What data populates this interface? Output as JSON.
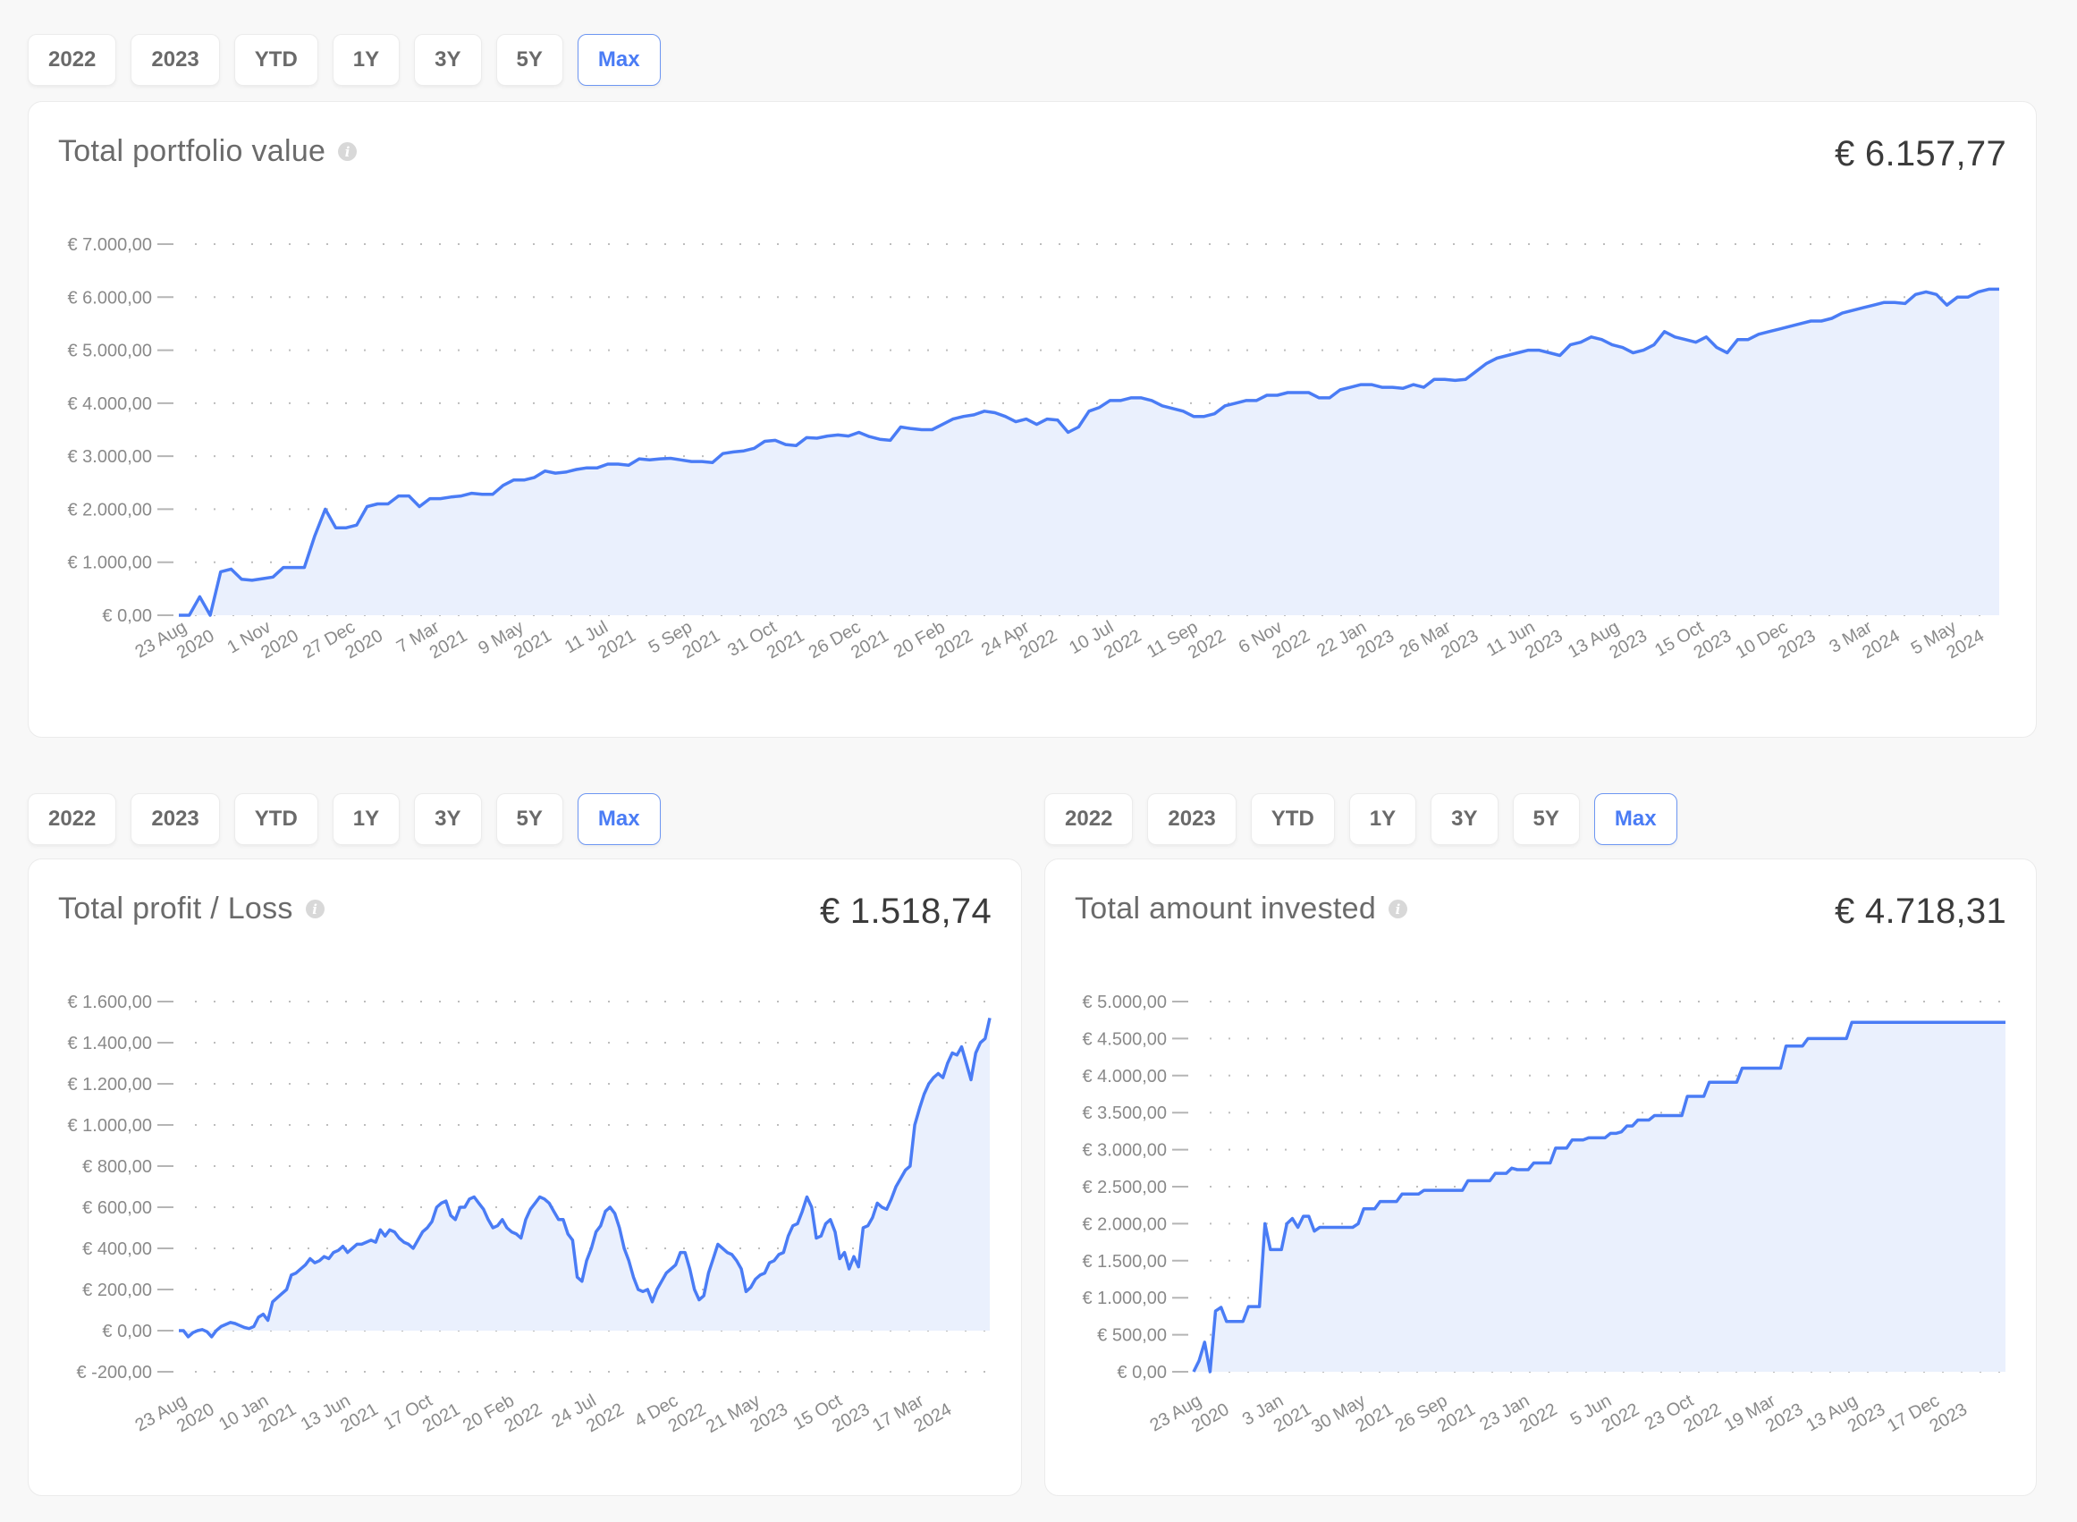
{
  "filters": [
    "2022",
    "2023",
    "YTD",
    "1Y",
    "3Y",
    "5Y",
    "Max"
  ],
  "active_filter": "Max",
  "colors": {
    "accent": "#4a7cf5",
    "line": "#4a7cf5",
    "fill": "#eaf0fd",
    "grid": "#bdbdbd",
    "background": "#f8f8f8"
  },
  "cards": {
    "portfolio": {
      "title": "Total portfolio value",
      "value": "€ 6.157,77"
    },
    "profit": {
      "title": "Total profit / Loss",
      "value": "€ 1.518,74"
    },
    "invested": {
      "title": "Total amount invested",
      "value": "€ 4.718,31"
    }
  },
  "chart_data": [
    {
      "type": "area",
      "title": "Total portfolio value",
      "ylabel": "EUR",
      "ylim": [
        0,
        7000
      ],
      "yticks": [
        0,
        1000,
        2000,
        3000,
        4000,
        5000,
        6000,
        7000
      ],
      "ytick_labels": [
        "€ 0,00",
        "€ 1.000,00",
        "€ 2.000,00",
        "€ 3.000,00",
        "€ 4.000,00",
        "€ 5.000,00",
        "€ 6.000,00",
        "€ 7.000,00"
      ],
      "xtick_labels": [
        [
          "23 Aug",
          "2020"
        ],
        [
          "1 Nov",
          "2020"
        ],
        [
          "27 Dec",
          "2020"
        ],
        [
          "7 Mar",
          "2021"
        ],
        [
          "9 May",
          "2021"
        ],
        [
          "11 Jul",
          "2021"
        ],
        [
          "5 Sep",
          "2021"
        ],
        [
          "31 Oct",
          "2021"
        ],
        [
          "26 Dec",
          "2021"
        ],
        [
          "20 Feb",
          "2022"
        ],
        [
          "24 Apr",
          "2022"
        ],
        [
          "10 Jul",
          "2022"
        ],
        [
          "11 Sep",
          "2022"
        ],
        [
          "6 Nov",
          "2022"
        ],
        [
          "22 Jan",
          "2023"
        ],
        [
          "26 Mar",
          "2023"
        ],
        [
          "11 Jun",
          "2023"
        ],
        [
          "13 Aug",
          "2023"
        ],
        [
          "15 Oct",
          "2023"
        ],
        [
          "10 Dec",
          "2023"
        ],
        [
          "3 Mar",
          "2024"
        ],
        [
          "5 May",
          "2024"
        ]
      ],
      "grid": true,
      "values": [
        0,
        0,
        350,
        0,
        820,
        870,
        680,
        660,
        690,
        720,
        900,
        900,
        900,
        1500,
        2000,
        1650,
        1650,
        1700,
        2050,
        2100,
        2100,
        2250,
        2250,
        2050,
        2200,
        2200,
        2230,
        2250,
        2300,
        2280,
        2280,
        2450,
        2550,
        2550,
        2600,
        2720,
        2680,
        2700,
        2750,
        2780,
        2780,
        2850,
        2850,
        2830,
        2950,
        2930,
        2950,
        2960,
        2930,
        2900,
        2900,
        2880,
        3050,
        3080,
        3100,
        3150,
        3280,
        3300,
        3220,
        3200,
        3350,
        3340,
        3380,
        3400,
        3380,
        3450,
        3370,
        3320,
        3300,
        3550,
        3520,
        3500,
        3500,
        3600,
        3700,
        3750,
        3780,
        3850,
        3820,
        3750,
        3650,
        3700,
        3600,
        3700,
        3680,
        3450,
        3550,
        3850,
        3920,
        4050,
        4050,
        4100,
        4100,
        4050,
        3950,
        3900,
        3850,
        3750,
        3750,
        3800,
        3950,
        4000,
        4050,
        4050,
        4150,
        4150,
        4200,
        4200,
        4200,
        4100,
        4100,
        4250,
        4300,
        4350,
        4350,
        4300,
        4300,
        4280,
        4350,
        4300,
        4450,
        4450,
        4430,
        4450,
        4600,
        4750,
        4850,
        4900,
        4950,
        5000,
        5000,
        4950,
        4900,
        5100,
        5150,
        5250,
        5200,
        5100,
        5050,
        4950,
        5000,
        5100,
        5350,
        5250,
        5200,
        5150,
        5250,
        5050,
        4950,
        5200,
        5200,
        5300,
        5350,
        5400,
        5450,
        5500,
        5550,
        5550,
        5600,
        5700,
        5750,
        5800,
        5850,
        5900,
        5900,
        5880,
        6050,
        6100,
        6050,
        5850,
        6000,
        6000,
        6100,
        6150,
        6150
      ],
      "last_value": 6157.77
    },
    {
      "type": "area",
      "title": "Total profit / Loss",
      "ylabel": "EUR",
      "ylim": [
        -200,
        1600
      ],
      "yticks": [
        -200,
        0,
        200,
        400,
        600,
        800,
        1000,
        1200,
        1400,
        1600
      ],
      "ytick_labels": [
        "€ -200,00",
        "€ 0,00",
        "€ 200,00",
        "€ 400,00",
        "€ 600,00",
        "€ 800,00",
        "€ 1.000,00",
        "€ 1.200,00",
        "€ 1.400,00",
        "€ 1.600,00"
      ],
      "xtick_labels": [
        [
          "23 Aug",
          "2020"
        ],
        [
          "10 Jan",
          "2021"
        ],
        [
          "13 Jun",
          "2021"
        ],
        [
          "17 Oct",
          "2021"
        ],
        [
          "20 Feb",
          "2022"
        ],
        [
          "24 Jul",
          "2022"
        ],
        [
          "4 Dec",
          "2022"
        ],
        [
          "21 May",
          "2023"
        ],
        [
          "15 Oct",
          "2023"
        ],
        [
          "17 Mar",
          "2024"
        ]
      ],
      "grid": true,
      "values": [
        0,
        0,
        -30,
        -10,
        0,
        5,
        -5,
        -30,
        0,
        20,
        30,
        40,
        35,
        25,
        15,
        10,
        20,
        65,
        80,
        50,
        140,
        160,
        180,
        200,
        270,
        280,
        300,
        320,
        350,
        330,
        340,
        360,
        350,
        380,
        390,
        410,
        380,
        400,
        420,
        420,
        430,
        440,
        430,
        490,
        460,
        490,
        480,
        450,
        430,
        420,
        400,
        440,
        480,
        500,
        530,
        600,
        620,
        630,
        560,
        540,
        600,
        600,
        640,
        650,
        620,
        590,
        540,
        500,
        510,
        540,
        500,
        480,
        470,
        450,
        540,
        590,
        620,
        650,
        640,
        620,
        580,
        540,
        540,
        470,
        440,
        260,
        240,
        340,
        400,
        480,
        510,
        580,
        600,
        570,
        500,
        400,
        340,
        260,
        200,
        190,
        200,
        140,
        200,
        240,
        280,
        300,
        320,
        380,
        380,
        300,
        200,
        150,
        170,
        280,
        350,
        420,
        400,
        380,
        370,
        340,
        300,
        190,
        210,
        250,
        270,
        280,
        330,
        340,
        370,
        380,
        460,
        510,
        520,
        580,
        650,
        600,
        450,
        460,
        520,
        540,
        480,
        350,
        380,
        300,
        360,
        310,
        500,
        510,
        550,
        620,
        600,
        590,
        640,
        700,
        740,
        780,
        800,
        1000,
        1080,
        1150,
        1200,
        1230,
        1250,
        1230,
        1300,
        1350,
        1340,
        1380,
        1300,
        1220,
        1350,
        1400,
        1420,
        1520
      ]
    },
    {
      "type": "area",
      "title": "Total amount invested",
      "ylabel": "EUR",
      "ylim": [
        0,
        5000
      ],
      "yticks": [
        0,
        500,
        1000,
        1500,
        2000,
        2500,
        3000,
        3500,
        4000,
        4500,
        5000
      ],
      "ytick_labels": [
        "€ 0,00",
        "€ 500,00",
        "€ 1.000,00",
        "€ 1.500,00",
        "€ 2.000,00",
        "€ 2.500,00",
        "€ 3.000,00",
        "€ 3.500,00",
        "€ 4.000,00",
        "€ 4.500,00",
        "€ 5.000,00"
      ],
      "xtick_labels": [
        [
          "23 Aug",
          "2020"
        ],
        [
          "3 Jan",
          "2021"
        ],
        [
          "30 May",
          "2021"
        ],
        [
          "26 Sep",
          "2021"
        ],
        [
          "23 Jan",
          "2022"
        ],
        [
          "5 Jun",
          "2022"
        ],
        [
          "23 Oct",
          "2022"
        ],
        [
          "19 Mar",
          "2023"
        ],
        [
          "13 Aug",
          "2023"
        ],
        [
          "17 Dec",
          "2023"
        ]
      ],
      "grid": true,
      "values": [
        0,
        150,
        400,
        0,
        820,
        870,
        680,
        680,
        680,
        680,
        880,
        880,
        880,
        2000,
        1650,
        1650,
        1650,
        2000,
        2070,
        1950,
        2100,
        2100,
        1900,
        1950,
        1950,
        1950,
        1950,
        1950,
        1950,
        1950,
        2000,
        2200,
        2200,
        2200,
        2300,
        2300,
        2300,
        2300,
        2400,
        2400,
        2400,
        2400,
        2450,
        2450,
        2450,
        2450,
        2450,
        2450,
        2450,
        2450,
        2580,
        2580,
        2580,
        2580,
        2580,
        2680,
        2680,
        2680,
        2750,
        2730,
        2730,
        2730,
        2820,
        2820,
        2820,
        2820,
        3020,
        3020,
        3020,
        3130,
        3130,
        3130,
        3160,
        3160,
        3160,
        3160,
        3220,
        3220,
        3240,
        3320,
        3320,
        3400,
        3400,
        3400,
        3460,
        3460,
        3460,
        3460,
        3460,
        3460,
        3720,
        3720,
        3720,
        3720,
        3910,
        3910,
        3910,
        3910,
        3910,
        3910,
        4100,
        4100,
        4100,
        4100,
        4100,
        4100,
        4100,
        4100,
        4400,
        4400,
        4400,
        4400,
        4500,
        4500,
        4500,
        4500,
        4500,
        4500,
        4500,
        4500,
        4720,
        4720,
        4720,
        4720,
        4720,
        4720,
        4720,
        4720,
        4720,
        4720,
        4720,
        4720,
        4720,
        4720,
        4720,
        4720,
        4720,
        4720,
        4720,
        4720,
        4720,
        4720,
        4720,
        4720,
        4720,
        4720,
        4720,
        4720,
        4720
      ],
      "last_value": 4718.31
    }
  ]
}
